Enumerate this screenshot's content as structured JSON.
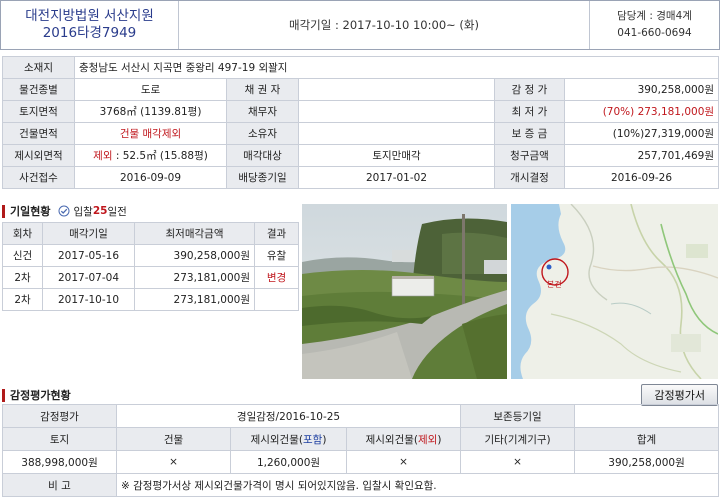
{
  "header": {
    "court": "대전지방법원 서산지원",
    "case_no": "2016타경7949",
    "sale_date": "매각기일 : 2017-10-10  10:00~ (화)",
    "dept": "담당계 : 경매4계",
    "phone": "041-660-0694"
  },
  "info": {
    "address_label": "소재지",
    "address": "충청남도 서산시 지곡면 중왕리 497-19 외꽐지",
    "r1": {
      "l1": "물건종별",
      "v1": "도로",
      "l2": "채 권 자",
      "v2": "",
      "l3": "감 정 가",
      "v3": "390,258,000원"
    },
    "r2": {
      "l1": "토지면적",
      "v1": "3768㎡ (1139.81평)",
      "l2": "채무자",
      "v2": "",
      "l3": "최 저 가",
      "v3": "(70%) 273,181,000원"
    },
    "r3": {
      "l1": "건물면적",
      "v1": "건물 매각제외",
      "l2": "소유자",
      "v2": "",
      "l3": "보 증 금",
      "v3": "(10%)27,319,000원"
    },
    "r4": {
      "l1": "제시외면적",
      "v1a": "제외",
      "v1b": " : 52.5㎡ (15.88평)",
      "l2": "매각대상",
      "v2": "토지만매각",
      "l3": "청구금액",
      "v3": "257,701,469원"
    },
    "r5": {
      "l1": "사건접수",
      "v1": "2016-09-09",
      "l2": "배당종기일",
      "v2": "2017-01-02",
      "l3": "개시결정",
      "v3": "2016-09-26"
    }
  },
  "bids": {
    "title": "기일현황",
    "remain_prefix": "입찰",
    "remain_days": "25",
    "remain_suffix": "일전",
    "headers": [
      "회차",
      "매각기일",
      "최저매각금액",
      "결과"
    ],
    "rows": [
      {
        "round": "신건",
        "date": "2017-05-16",
        "price": "390,258,000원",
        "result": "유찰"
      },
      {
        "round": "2차",
        "date": "2017-07-04",
        "price": "273,181,000원",
        "result": "변경"
      },
      {
        "round": "2차",
        "date": "2017-10-10",
        "price": "273,181,000원",
        "result": ""
      }
    ]
  },
  "map": {
    "marker_label": "본건"
  },
  "appraisal": {
    "title": "감정평가현황",
    "button": "감정평가서",
    "r1": {
      "l1": "감정평가",
      "v1": "경일감정/2016-10-25",
      "l2": "보존등기일",
      "v2": ""
    },
    "headers": {
      "h1": "토지",
      "h2": "건물",
      "h3a": "제시외건물(",
      "h3b": "포함",
      "h3c": ")",
      "h4a": "제시외건물(",
      "h4b": "제외",
      "h4c": ")",
      "h5": "기타(기계기구)",
      "h6": "합계"
    },
    "values": {
      "v1": "388,998,000원",
      "v2": "×",
      "v3": "1,260,000원",
      "v4": "×",
      "v5": "×",
      "v6": "390,258,000원"
    },
    "note_label": "비 고",
    "note": "※ 감정평가서상 제시외건물가격이 명시 되어있지않음. 입찰시 확인요함."
  },
  "colors": {
    "accent_blue": "#2a3c8c",
    "accent_red": "#c0171d",
    "label_bg": "#e9ebef"
  }
}
